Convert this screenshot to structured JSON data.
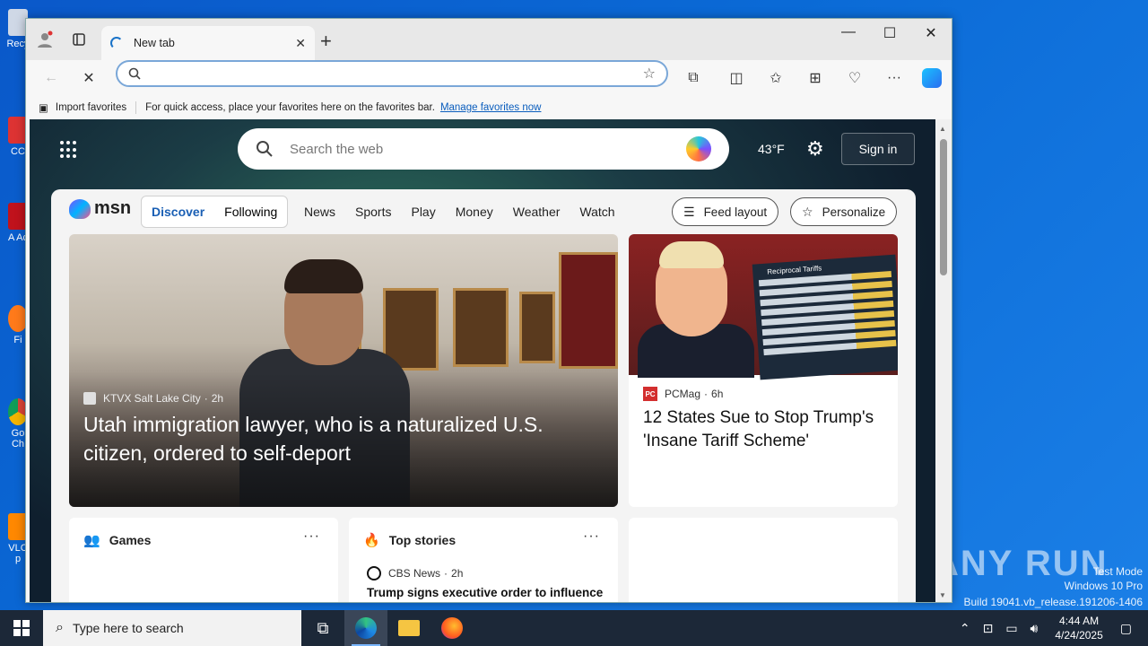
{
  "desktop": {
    "icons": [
      "Recy",
      "CC",
      "A Ac",
      "Fi",
      "Go Ch",
      "VLC p"
    ],
    "watermark": "ANY RUN",
    "test_mode": "Test Mode",
    "os": "Windows 10 Pro",
    "build": "Build 19041.vb_release.191206-1406"
  },
  "browser": {
    "tab_title": "New tab",
    "address_value": "",
    "favorites_bar": {
      "import_label": "Import favorites",
      "hint": "For quick access, place your favorites here on the favorites bar.",
      "manage_link": "Manage favorites now"
    }
  },
  "msn": {
    "search_placeholder": "Search the web",
    "weather": "43°F",
    "sign_in": "Sign in",
    "logo": "msn",
    "segments": [
      "Discover",
      "Following"
    ],
    "nav": [
      "News",
      "Sports",
      "Play",
      "Money",
      "Weather",
      "Watch"
    ],
    "feed_layout": "Feed layout",
    "personalize": "Personalize",
    "hero": {
      "source": "KTVX Salt Lake City",
      "age": "2h",
      "headline": "Utah immigration lawyer, who is a naturalized U.S. citizen, ordered to self-deport"
    },
    "card2": {
      "source": "PCMag",
      "age": "6h",
      "logo_text": "PC",
      "headline": "12 States Sue to Stop Trump's 'Insane Tariff Scheme'",
      "board_title": "Reciprocal Tariffs"
    },
    "games": {
      "title": "Games",
      "more": "···"
    },
    "top_stories": {
      "title": "Top stories",
      "more": "···",
      "source": "CBS News",
      "age": "2h",
      "headline": "Trump signs executive order to influence"
    }
  },
  "taskbar": {
    "search_placeholder": "Type here to search",
    "time": "4:44 AM",
    "date": "4/24/2025"
  }
}
